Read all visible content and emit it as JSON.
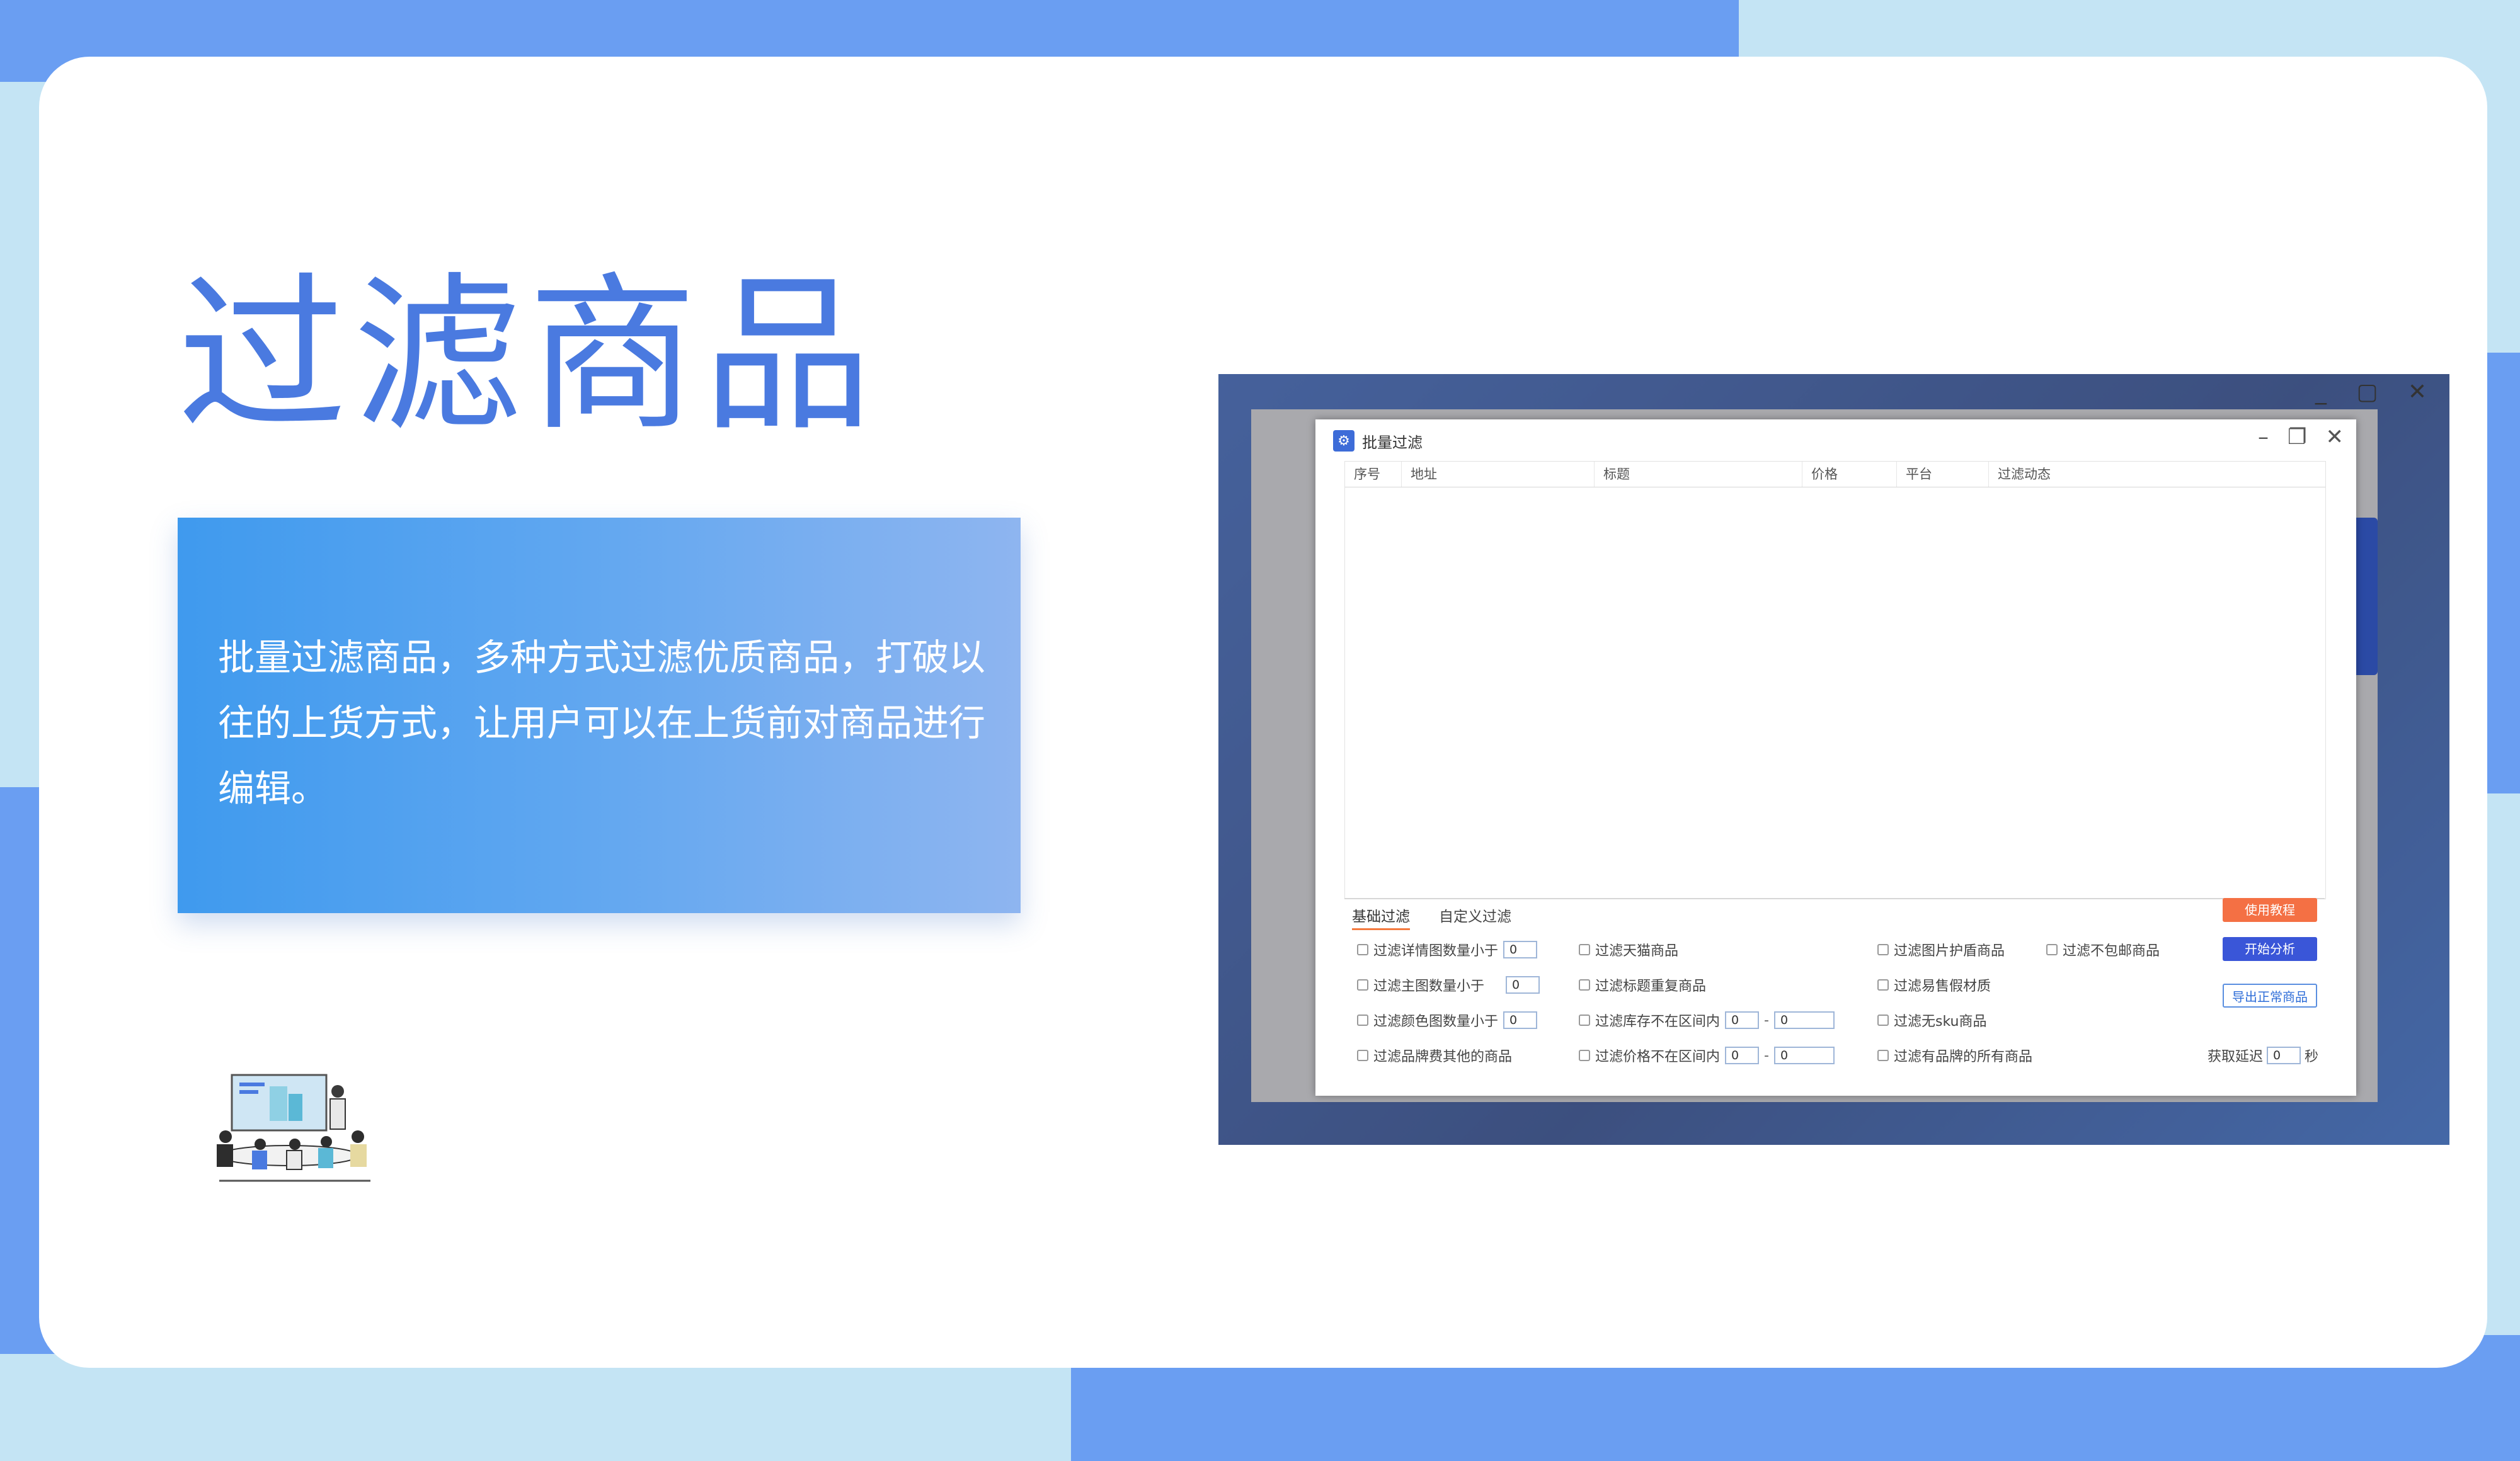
{
  "slide": {
    "title": "过滤商品",
    "description": "批量过滤商品，多种方式过滤优质商品，打破以往的上货方式，让用户可以在上货前对商品进行编辑。"
  },
  "colors": {
    "accent": "#4a7ae0",
    "background_blob": "#6a9ef2",
    "orange_button": "#f47044",
    "blue_button": "#3a56d8"
  },
  "dialog": {
    "title": "批量过滤",
    "icons": [
      "minimize-icon",
      "restore-icon",
      "close-icon"
    ],
    "columns": [
      "序号",
      "地址",
      "标题",
      "价格",
      "平台",
      "过滤动态"
    ],
    "tabs": [
      "基础过滤",
      "自定义过滤"
    ],
    "buttons": {
      "tutorial": "使用教程",
      "start": "开始分析",
      "export": "导出正常商品"
    },
    "options": {
      "detail_img": "过滤详情图数量小于",
      "detail_img_value": "0",
      "main_img": "过滤主图数量小于",
      "main_img_value": "0",
      "color_img": "过滤颜色图数量小于",
      "color_img_value": "0",
      "brand_fee": "过滤品牌费其他的商品",
      "tmall": "过滤天猫商品",
      "dup_title": "过滤标题重复商品",
      "stock_range": "过滤库存不在区间内",
      "stock_min": "0",
      "stock_max": "0",
      "price_range": "过滤价格不在区间内",
      "price_min": "0",
      "price_max": "0",
      "shield": "过滤图片护盾商品",
      "fake": "过滤易售假材质",
      "no_sku": "过滤无sku商品",
      "brand_all": "过滤有品牌的所有商品",
      "no_free_ship": "过滤不包邮商品",
      "delay_label": "获取延迟",
      "delay_value": "0",
      "delay_unit": "秒"
    }
  }
}
